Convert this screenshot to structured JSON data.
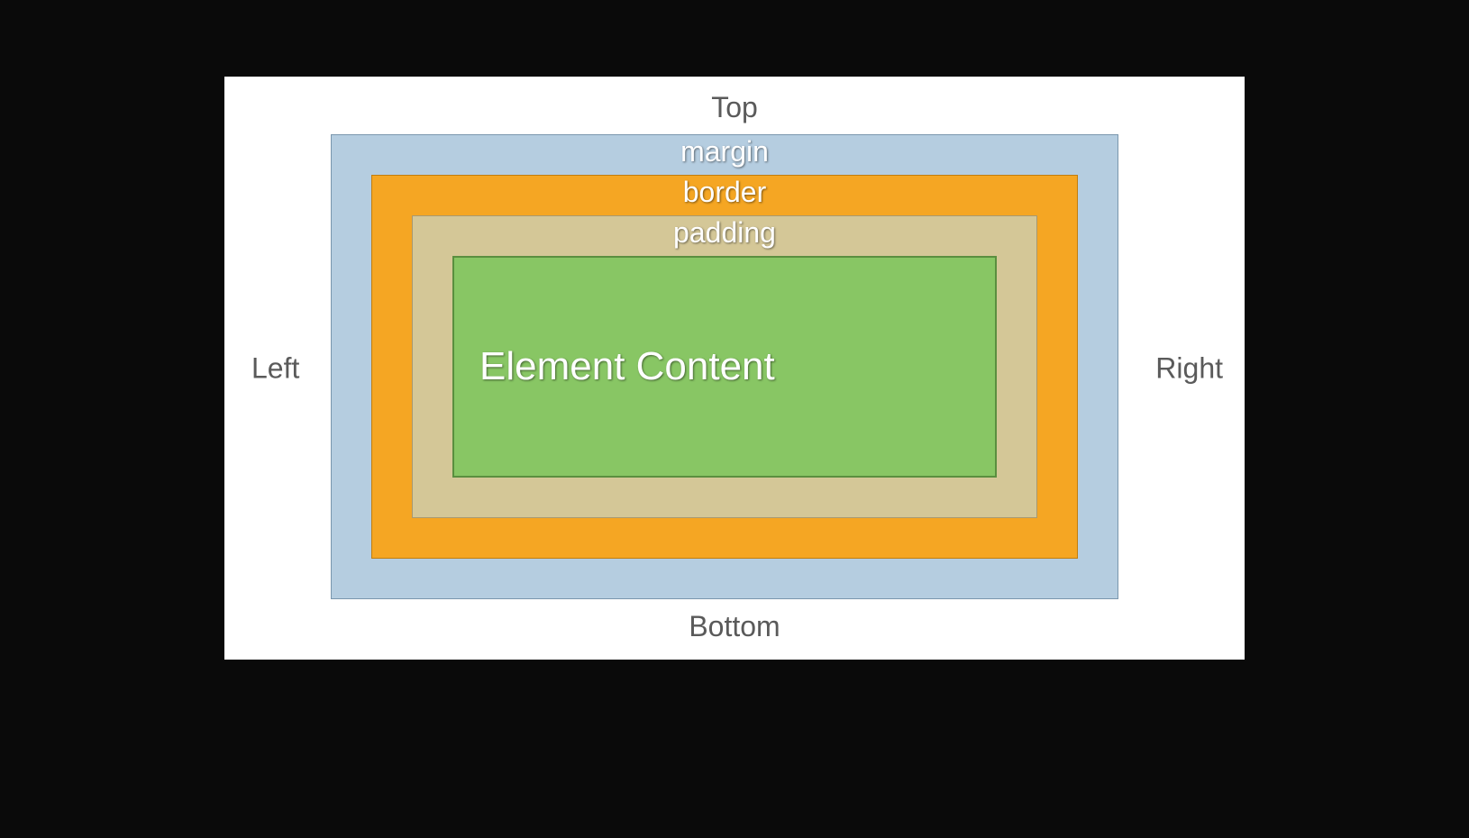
{
  "diagram": {
    "edges": {
      "top": "Top",
      "bottom": "Bottom",
      "left": "Left",
      "right": "Right"
    },
    "layers": {
      "margin": "margin",
      "border": "border",
      "padding": "padding",
      "content": "Element Content"
    },
    "colors": {
      "margin": "#b5cde0",
      "border": "#f5a623",
      "padding": "#d4c797",
      "content": "#88c664",
      "background": "#ffffff",
      "page": "#0a0a0a"
    }
  }
}
